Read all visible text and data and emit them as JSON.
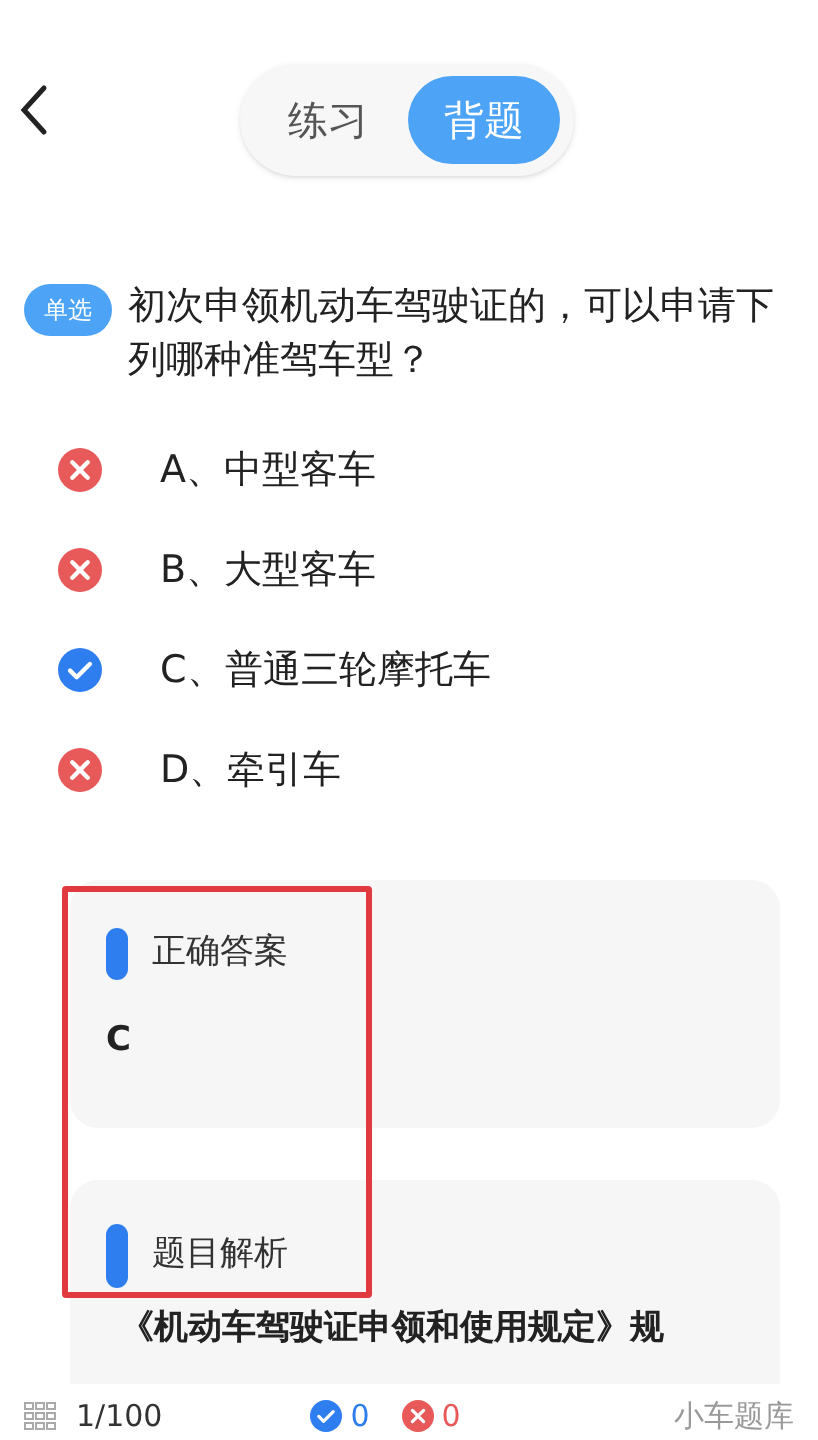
{
  "modes": [
    {
      "label": "练习",
      "selected": false
    },
    {
      "label": "背题",
      "selected": true
    }
  ],
  "question": {
    "type_badge": "单选",
    "text": "初次申领机动车驾驶证的，可以申请下列哪种准驾车型？"
  },
  "options": [
    {
      "label": "A、中型客车",
      "kind": "wrong"
    },
    {
      "label": "B、大型客车",
      "kind": "wrong"
    },
    {
      "label": "C、普通三轮摩托车",
      "kind": "correct"
    },
    {
      "label": "D、牵引车",
      "kind": "wrong"
    }
  ],
  "answer_card": {
    "title": "正确答案",
    "answer": "C"
  },
  "analysis_card": {
    "title": "题目解析",
    "text": "《机动车驾驶证申领和使用规定》规"
  },
  "highlight_frame": true,
  "bottom_bar": {
    "progress": "1/100",
    "correct_count": "0",
    "wrong_count": "0",
    "bank": "小车题库"
  }
}
